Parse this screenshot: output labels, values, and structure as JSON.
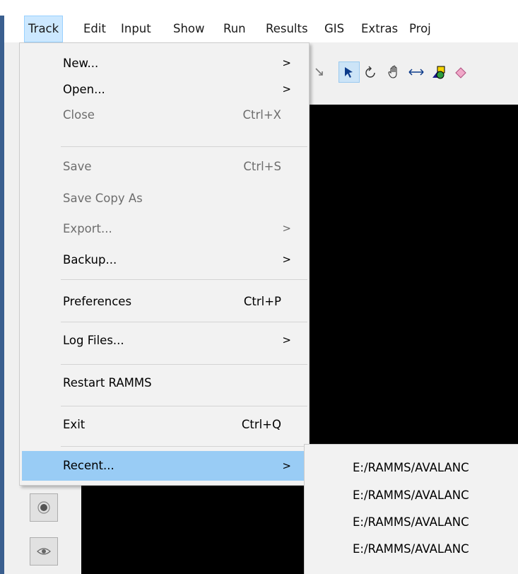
{
  "menubar": [
    "Track",
    "Edit",
    "Input",
    "Show",
    "Run",
    "Results",
    "GIS",
    "Extras",
    "Proj"
  ],
  "track_menu": {
    "new": {
      "label": "New..."
    },
    "open": {
      "label": "Open..."
    },
    "close": {
      "label": "Close",
      "shortcut": "Ctrl+X"
    },
    "save": {
      "label": "Save",
      "shortcut": "Ctrl+S"
    },
    "save_copy": {
      "label": "Save Copy As"
    },
    "export": {
      "label": "Export..."
    },
    "backup": {
      "label": "Backup..."
    },
    "preferences": {
      "label": "Preferences",
      "shortcut": "Ctrl+P"
    },
    "log_files": {
      "label": "Log Files..."
    },
    "restart": {
      "label": "Restart RAMMS"
    },
    "exit": {
      "label": "Exit",
      "shortcut": "Ctrl+Q"
    },
    "recent": {
      "label": "Recent..."
    }
  },
  "submenu_arrow": ">",
  "recent_files": [
    "E:/RAMMS/AVALANC",
    "E:/RAMMS/AVALANC",
    "E:/RAMMS/AVALANC",
    "E:/RAMMS/AVALANC"
  ],
  "toolbar_icons": [
    "zoom-fit-icon",
    "arrow-pointer-icon",
    "rotate-icon",
    "pan-hand-icon",
    "measure-distance-icon",
    "shapes-icon",
    "eraser-icon"
  ],
  "colors": {
    "highlight": "#99ccf5",
    "menu_bg": "#f2f2f2",
    "active_menubar": "#cce8ff",
    "accent": "#3a5f8f"
  }
}
